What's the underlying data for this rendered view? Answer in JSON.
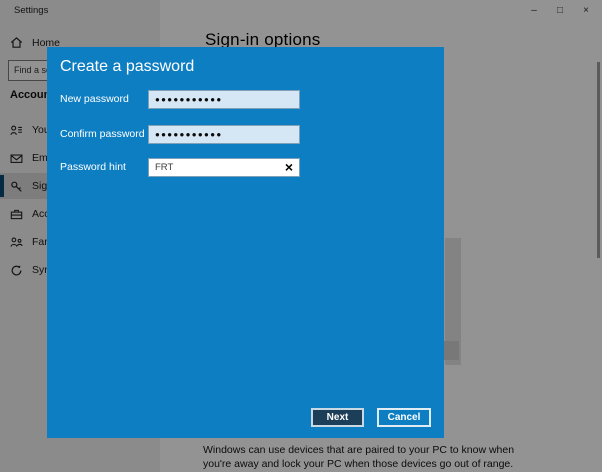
{
  "window": {
    "title": "Settings",
    "controls": {
      "minimize": "–",
      "maximize": "□",
      "close": "×"
    }
  },
  "sidebar": {
    "home_label": "Home",
    "search_value": "Find a se",
    "section_label": "Accounts",
    "items": [
      {
        "label": "Your",
        "icon": "person-card-icon",
        "selected": false
      },
      {
        "label": "Email",
        "icon": "email-icon",
        "selected": false
      },
      {
        "label": "Sign-",
        "icon": "key-icon",
        "selected": true
      },
      {
        "label": "Acce",
        "icon": "briefcase-icon",
        "selected": false
      },
      {
        "label": "Famil",
        "icon": "family-icon",
        "selected": false
      },
      {
        "label": "Sync",
        "icon": "sync-icon",
        "selected": false
      }
    ]
  },
  "main": {
    "heading": "Sign-in options",
    "footnote_line1": "Windows can use devices that are paired to your PC to know when",
    "footnote_line2": "you're away and lock your PC when those devices go out of range."
  },
  "dialog": {
    "title": "Create a password",
    "fields": [
      {
        "label": "New password",
        "value": "●●●●●●●●●●●",
        "masked": true
      },
      {
        "label": "Confirm password",
        "value": "●●●●●●●●●●●",
        "masked": true
      },
      {
        "label": "Password hint",
        "value": "FRT",
        "masked": false
      }
    ],
    "clear_icon": "×",
    "next_label": "Next",
    "cancel_label": "Cancel"
  },
  "colors": {
    "dialog_bg": "#0e7ec2",
    "field_bg": "#d5e7f5",
    "next_button_bg": "#1d3e58",
    "selection_indicator": "#0a4a76"
  }
}
